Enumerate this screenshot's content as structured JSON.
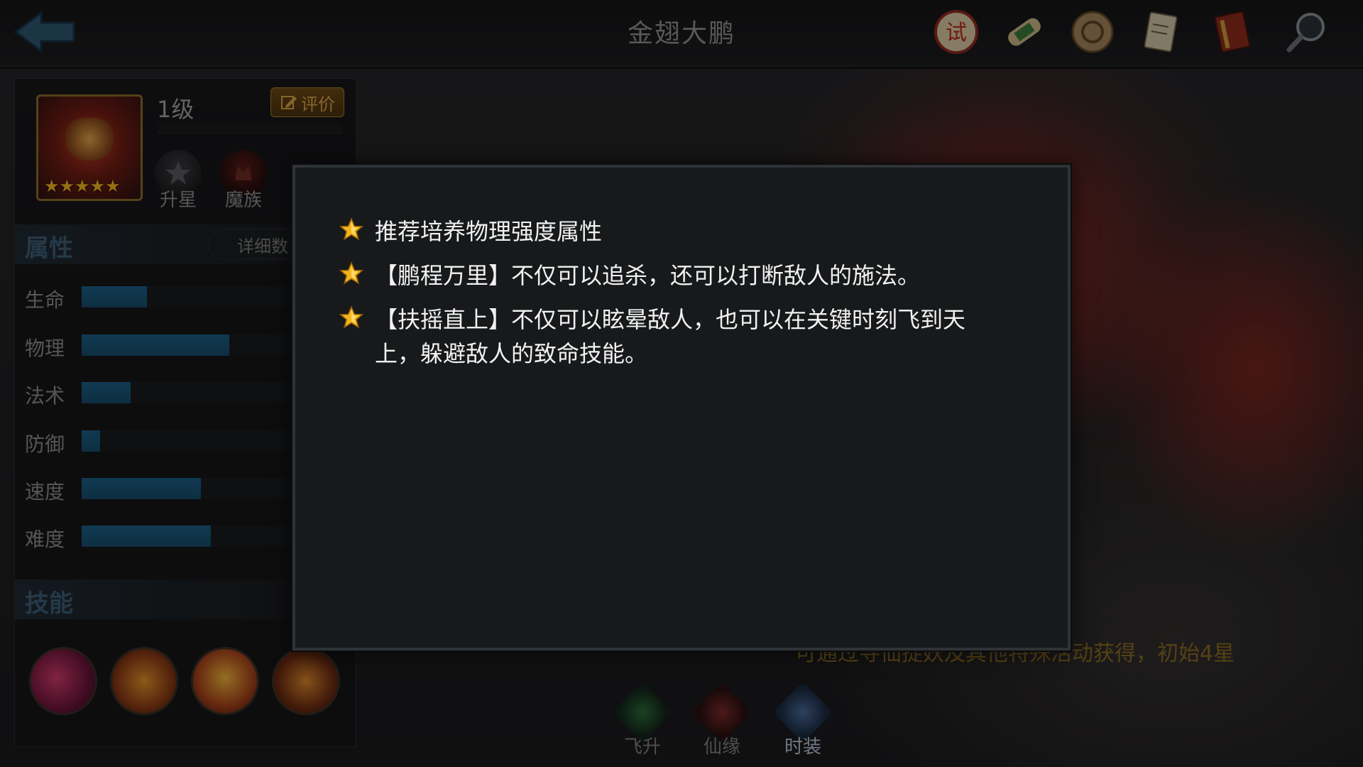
{
  "header": {
    "title": "金翅大鹏",
    "icons": [
      "trial-seal-icon",
      "scroll-icon",
      "coin-icon",
      "document-icon",
      "book-icon",
      "magnifier-icon"
    ],
    "trial_seal_glyph": "试"
  },
  "hero": {
    "level": "1级",
    "eval_label": "评价",
    "stars": "★★★★★",
    "badges": [
      {
        "label": "升星"
      },
      {
        "label": "魔族"
      }
    ]
  },
  "attributes": {
    "heading": "属性",
    "detail_label": "详细数",
    "stats": [
      {
        "name": "生命",
        "value": 0.28
      },
      {
        "name": "物理",
        "value": 0.63
      },
      {
        "name": "法术",
        "value": 0.21
      },
      {
        "name": "防御",
        "value": 0.08
      },
      {
        "name": "速度",
        "value": 0.51
      },
      {
        "name": "难度",
        "value": 0.55
      }
    ]
  },
  "skills": {
    "heading": "技能"
  },
  "features": [
    {
      "label": "飞升"
    },
    {
      "label": "仙缘"
    },
    {
      "label": "时装"
    }
  ],
  "notice": "可通过寻仙捉妖及其他特殊活动获得，初始4星",
  "dialog": {
    "tips": [
      "推荐培养物理强度属性",
      "【鹏程万里】不仅可以追杀，还可以打断敌人的施法。",
      "【扶摇直上】不仅可以眩晕敌人，也可以在关键时刻飞到天上，躲避敌人的致命技能。"
    ]
  },
  "colors": {
    "accent_gold": "#f2b51c",
    "stat_bar": "#1c5e86",
    "section_heading": "#3d5d74"
  }
}
